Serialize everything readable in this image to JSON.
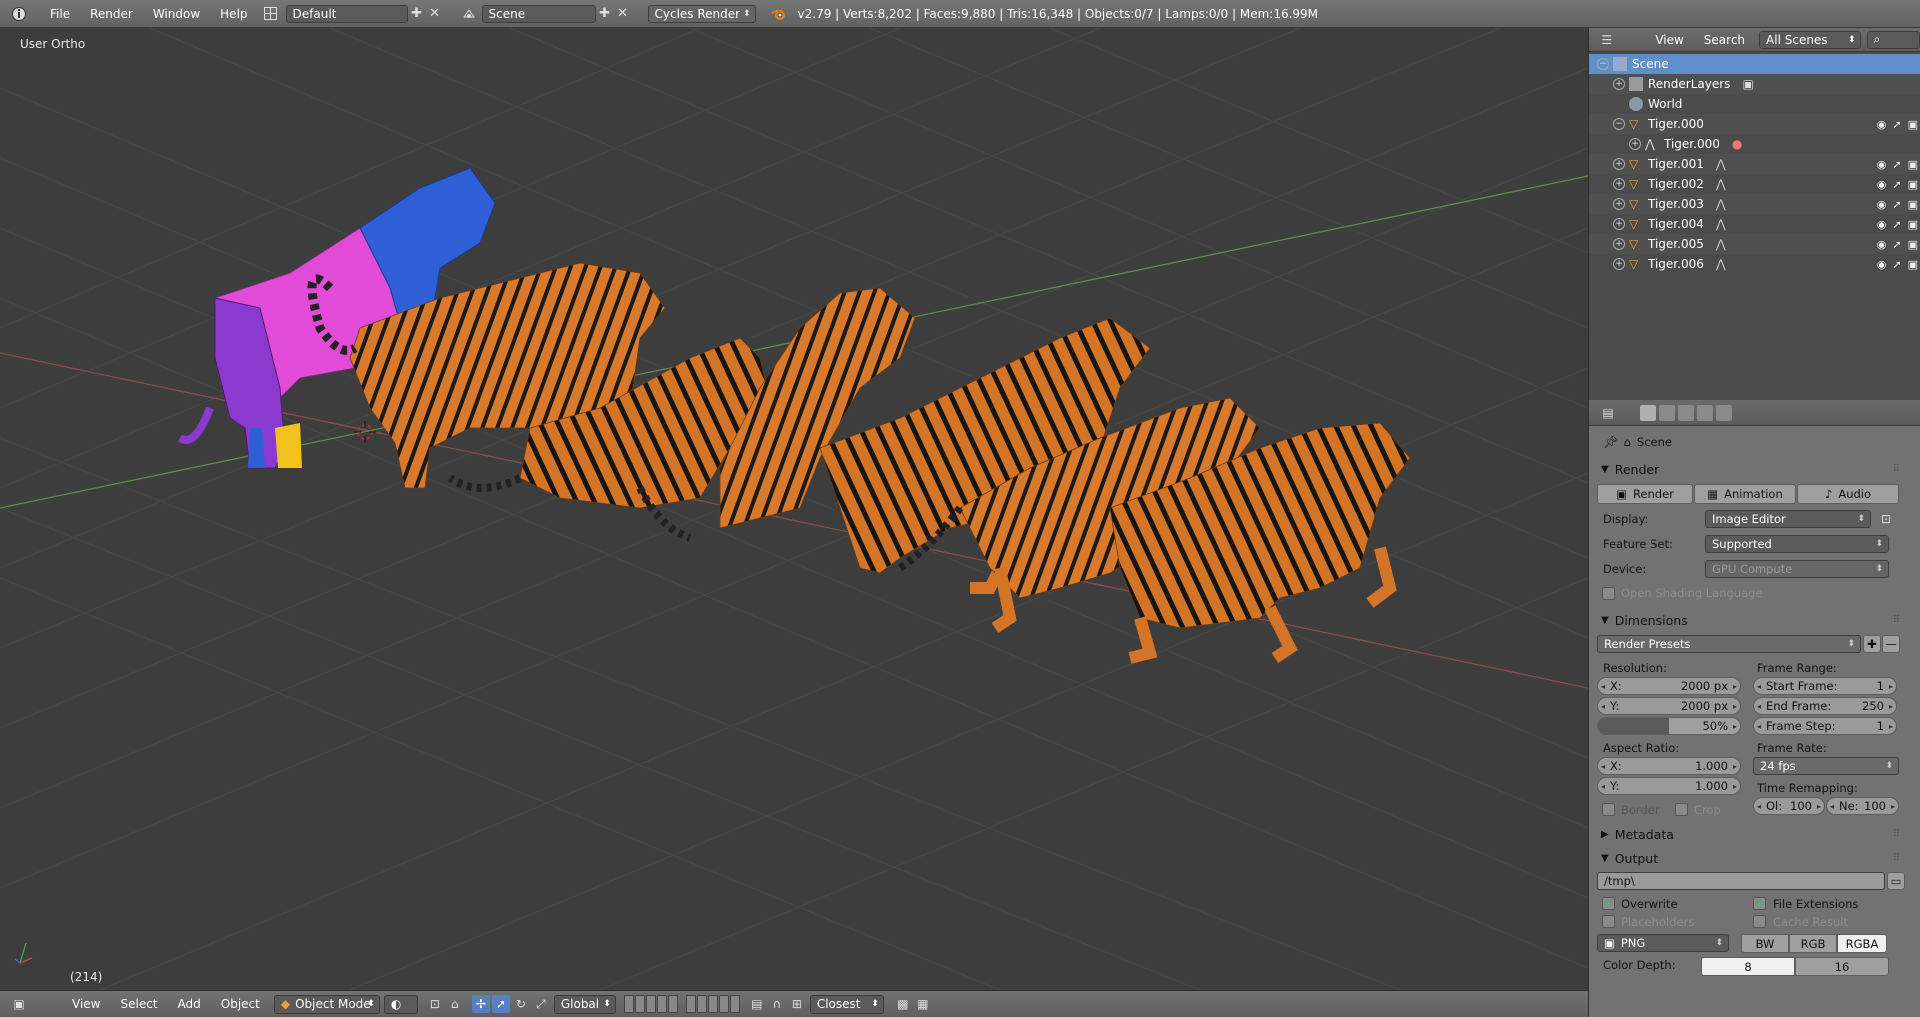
{
  "topbar": {
    "menus": [
      "File",
      "Render",
      "Window",
      "Help"
    ],
    "layout": "Default",
    "scene": "Scene",
    "engine": "Cycles Render",
    "stats": "v2.79 | Verts:8,202 | Faces:9,880 | Tris:16,348 | Objects:0/7 | Lamps:0/0 | Mem:16.99M"
  },
  "viewport": {
    "view_label": "User Ortho",
    "frame_label": "(214)"
  },
  "bottombar": {
    "menus": [
      "View",
      "Select",
      "Add",
      "Object"
    ],
    "mode": "Object Mode",
    "orientation": "Global",
    "snap": "Closest"
  },
  "outliner": {
    "menus": [
      "View",
      "Search"
    ],
    "filter": "All Scenes",
    "items": [
      {
        "label": "Scene",
        "icon": "scene-icon"
      },
      {
        "label": "RenderLayers",
        "icon": "renderlayers-icon"
      },
      {
        "label": "World",
        "icon": "world-icon"
      },
      {
        "label": "Tiger.000",
        "icon": "armature-icon"
      },
      {
        "label": "Tiger.000",
        "icon": "mesh-icon"
      },
      {
        "label": "Tiger.001",
        "icon": "armature-icon"
      },
      {
        "label": "Tiger.002",
        "icon": "armature-icon"
      },
      {
        "label": "Tiger.003",
        "icon": "armature-icon"
      },
      {
        "label": "Tiger.004",
        "icon": "armature-icon"
      },
      {
        "label": "Tiger.005",
        "icon": "armature-icon"
      },
      {
        "label": "Tiger.006",
        "icon": "armature-icon"
      }
    ]
  },
  "props": {
    "context": "Scene",
    "render": {
      "title": "Render",
      "buttons": [
        "Render",
        "Animation",
        "Audio"
      ],
      "display_label": "Display:",
      "display_value": "Image Editor",
      "feature_label": "Feature Set:",
      "feature_value": "Supported",
      "device_label": "Device:",
      "device_value": "GPU Compute",
      "osl_label": "Open Shading Language"
    },
    "dimensions": {
      "title": "Dimensions",
      "presets": "Render Presets",
      "resolution_label": "Resolution:",
      "res_x_label": "X:",
      "res_x": "2000 px",
      "res_y_label": "Y:",
      "res_y": "2000 px",
      "res_pct": "50%",
      "res_pct_value": 0.5,
      "frame_range_label": "Frame Range:",
      "start_label": "Start Frame:",
      "start": "1",
      "end_label": "End Frame:",
      "end": "250",
      "step_label": "Frame Step:",
      "step": "1",
      "aspect_label": "Aspect Ratio:",
      "asp_x_label": "X:",
      "asp_x": "1.000",
      "asp_y_label": "Y:",
      "asp_y": "1.000",
      "frame_rate_label": "Frame Rate:",
      "frame_rate": "24 fps",
      "remap_label": "Time Remapping:",
      "old_label": "Ol:",
      "old": "100",
      "new_label": "Ne:",
      "new": "100",
      "border_label": "Border",
      "crop_label": "Crop"
    },
    "metadata_title": "Metadata",
    "output": {
      "title": "Output",
      "path": "/tmp\\",
      "overwrite": "Overwrite",
      "file_ext": "File Extensions",
      "placeholders": "Placeholders",
      "cache": "Cache Result",
      "format": "PNG",
      "bw": "BW",
      "rgb": "RGB",
      "rgba": "RGBA",
      "color_depth_label": "Color Depth:",
      "depth_8": "8",
      "depth_16": "16"
    }
  },
  "colors": {
    "viewport_bg": "#3d3d3d",
    "selection": "#5f8fc9",
    "tiger_orange": "#d9792b",
    "uv_magenta": "#e24ad8",
    "uv_blue": "#2f5fd6"
  }
}
